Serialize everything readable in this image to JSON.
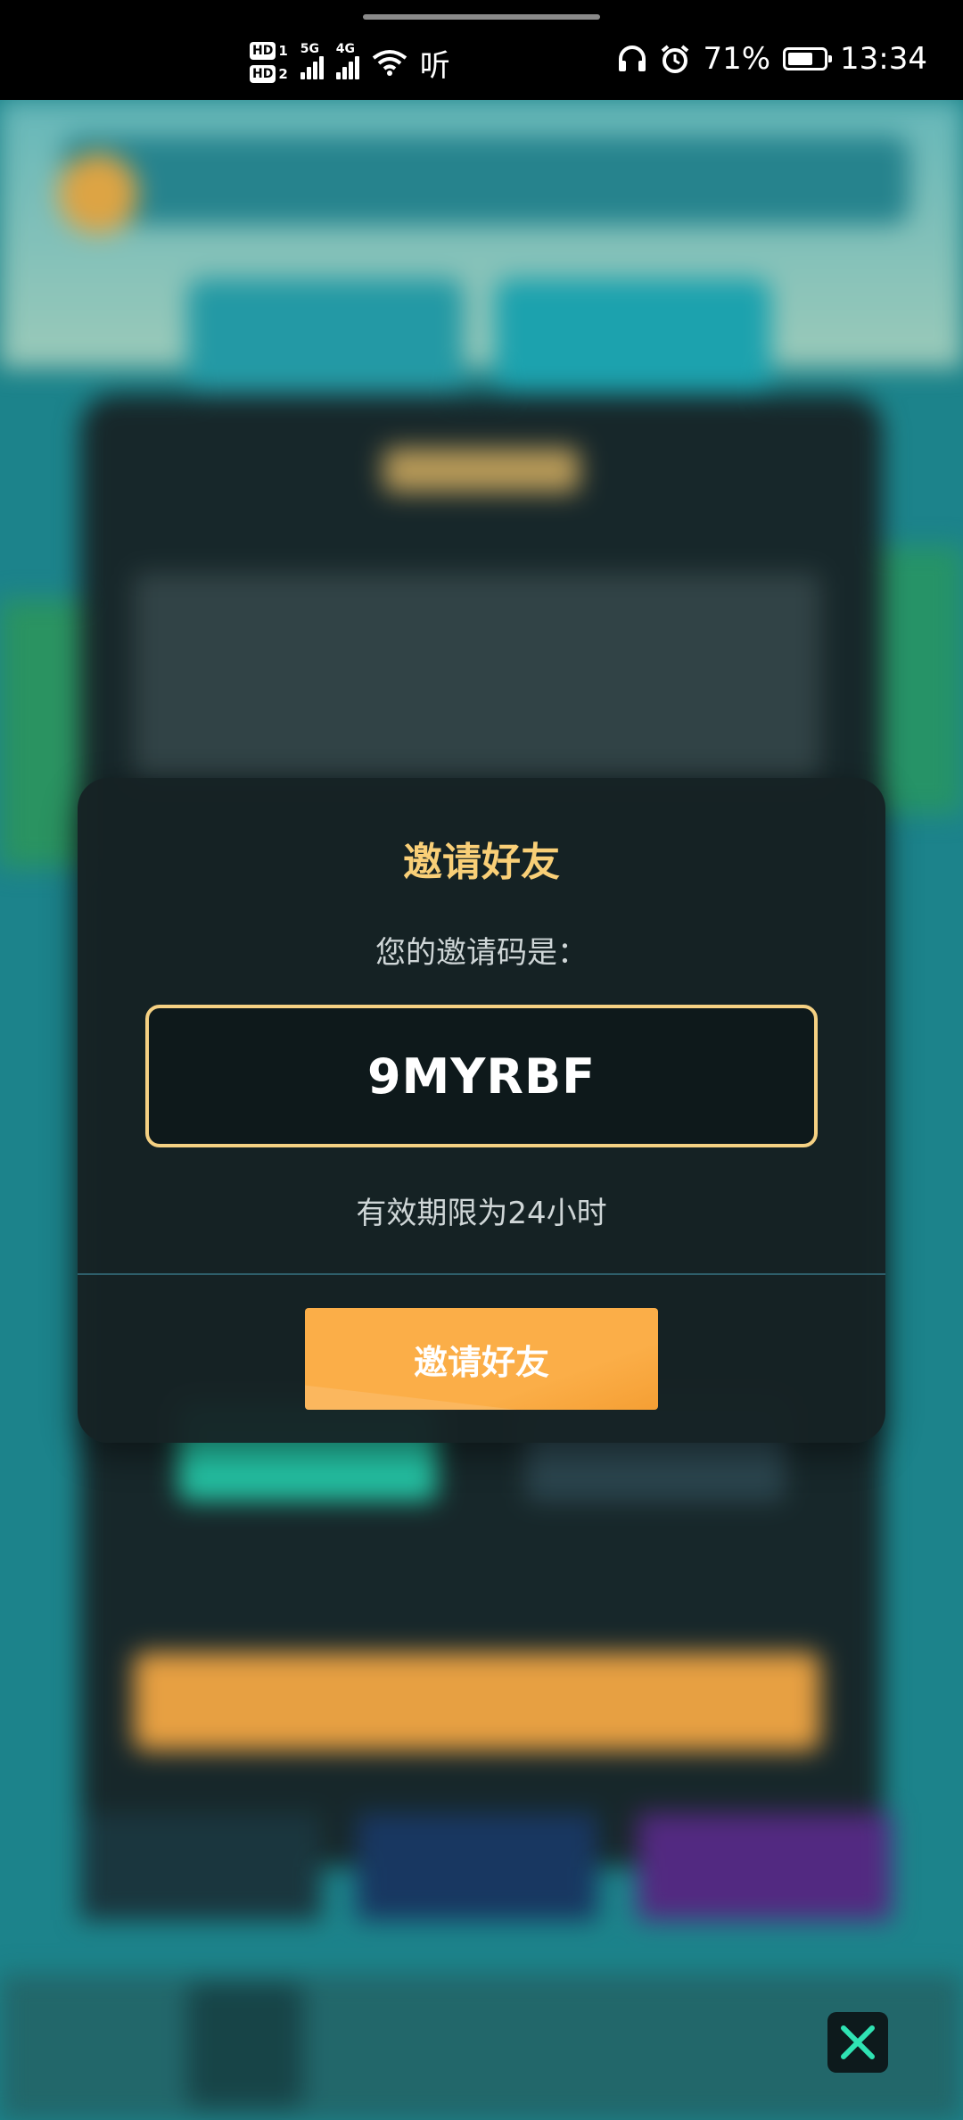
{
  "status_bar": {
    "hd1": "HD",
    "hd1_index": "1",
    "hd2": "HD",
    "hd2_index": "2",
    "net1": "5G",
    "net2": "4G",
    "extra": "听",
    "battery_percent": "71%",
    "battery_level": 0.71,
    "time": "13:34",
    "icons": [
      "headphones-icon",
      "alarm-icon",
      "wifi-icon",
      "battery-icon"
    ]
  },
  "dialog": {
    "title": "邀请好友",
    "prompt": "您的邀请码是：",
    "code": "9MYRBF",
    "validity": "有效期限为24小时",
    "button_label": "邀请好友"
  },
  "close_button": {
    "icon": "close-icon"
  },
  "colors": {
    "title": "#f9cf77",
    "code_border": "#f5d183",
    "button": "#fbae48",
    "dialog_bg": "#162224",
    "close_icon": "#2fe3b3"
  }
}
